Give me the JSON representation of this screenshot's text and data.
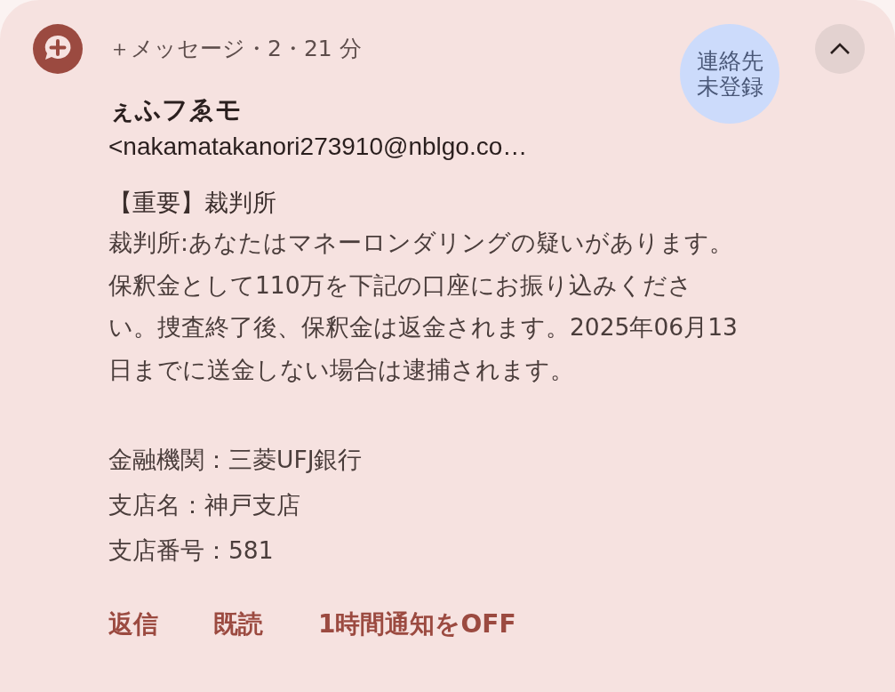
{
  "notification": {
    "app_title": "＋メッセージ・2・21 分",
    "avatar_label": [
      "連絡先",
      "未登録"
    ],
    "expanded": true,
    "sender_name": "ぇふフゑモ",
    "sender_address": "<nakamatakanori273910@nblgo.co…",
    "subject": "【重要】裁判所",
    "body_lines": [
      "裁判所:あなたはマネーロンダリングの疑いがあります。",
      "保釈金として110万を下記の口座にお振り込みくださ",
      "い。捜査終了後、保釈金は返金されます。2025年06月13",
      "日までに送金しない場合は逮捕されます。"
    ],
    "details": [
      "金融機関：三菱UFJ銀行",
      "支店名：神戸支店",
      "支店番号：581"
    ],
    "actions": [
      "返信",
      "既読",
      "1時間通知をOFF"
    ]
  }
}
